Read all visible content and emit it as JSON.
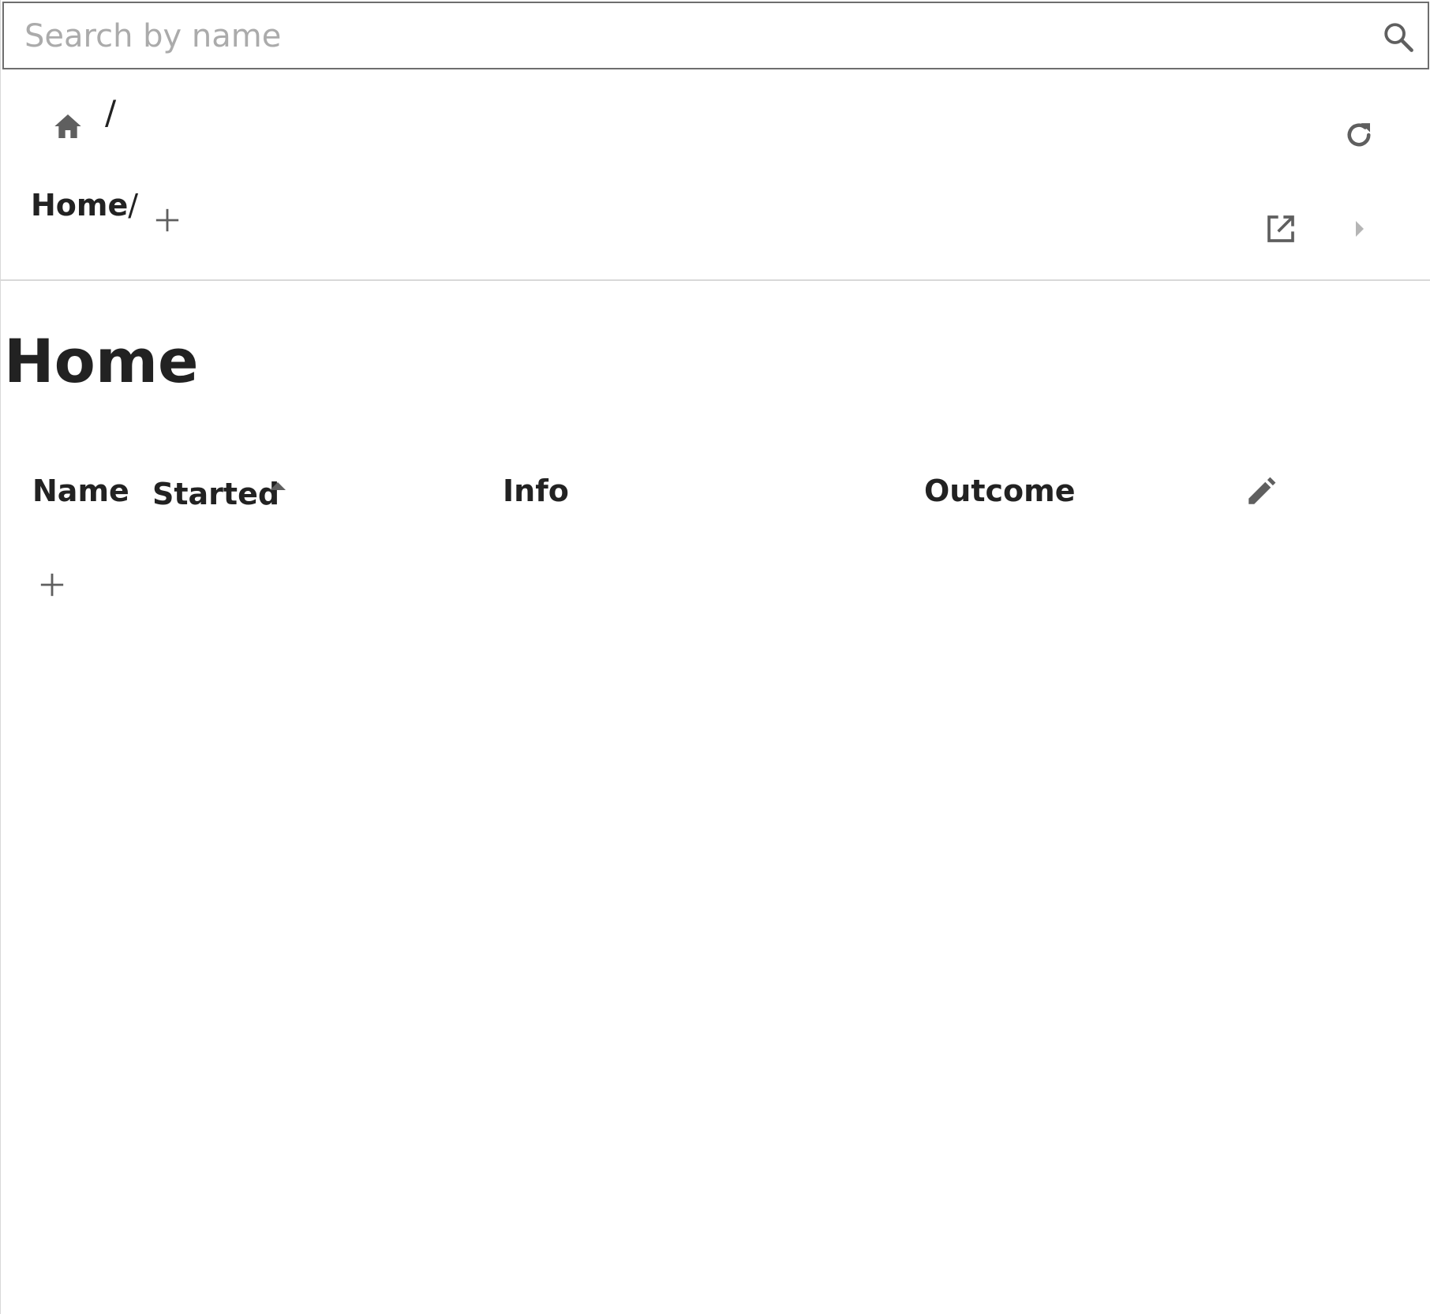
{
  "search": {
    "placeholder": "Search by name",
    "value": "",
    "icon": "search-icon"
  },
  "toolbar": {
    "separator": "/",
    "home_icon": "home-icon",
    "refresh_icon": "refresh-icon"
  },
  "breadcrumb": {
    "label": "Home",
    "separator": "/",
    "add_icon": "plus-icon",
    "open_icon": "open-in-new-icon",
    "next_icon": "chevron-right-icon"
  },
  "main": {
    "title": "Home",
    "table": {
      "columns": [
        {
          "label": "Name"
        },
        {
          "label": "Started",
          "sort": "ascending"
        },
        {
          "label": "Info"
        },
        {
          "label": "Outcome"
        }
      ],
      "rows": [],
      "edit_icon": "pencil-icon",
      "add_row_icon": "plus-icon"
    }
  },
  "colors": {
    "icon": "#5f5f5f",
    "text": "#222222",
    "placeholder": "#ababab",
    "border": "#6e6e6e",
    "divider": "#d8d8d8"
  }
}
